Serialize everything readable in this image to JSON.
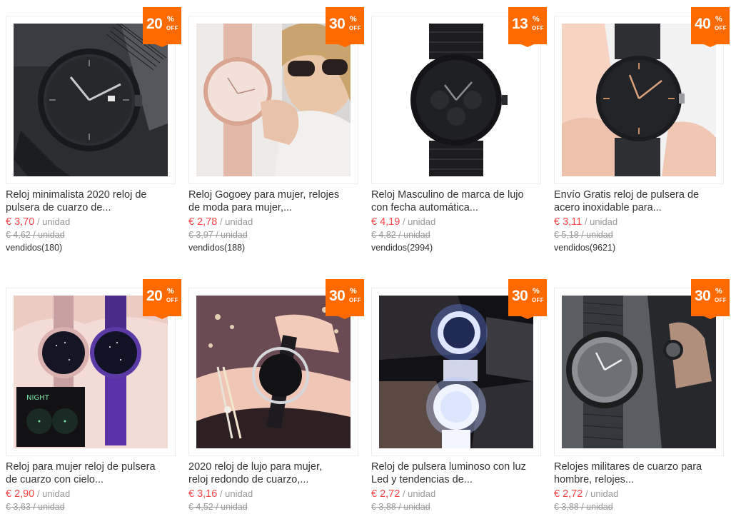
{
  "colors": {
    "accent": "#ff6a00",
    "price": "#ff4747",
    "muted": "#999999",
    "text": "#333333"
  },
  "products": [
    {
      "image": "watch-black-mesh",
      "discount": "20",
      "discount_pct": "%",
      "discount_off": "OFF",
      "title": "Reloj minimalista 2020 reloj de\npulsera de cuarzo de...",
      "price": "€ 3,70",
      "unit": " / unidad",
      "old_price": "€ 4,62 / unidad",
      "sold": "vendidos(180)"
    },
    {
      "image": "watch-pink-woman",
      "discount": "30",
      "discount_pct": "%",
      "discount_off": "OFF",
      "title": "Reloj Gogoey para mujer, relojes\nde moda para mujer,...",
      "price": "€ 2,78",
      "unit": " / unidad",
      "old_price": "€ 3,97 / unidad",
      "sold": "vendidos(188)"
    },
    {
      "image": "watch-black-steel",
      "discount": "13",
      "discount_pct": "%",
      "discount_off": "OFF",
      "title": "Reloj Masculino de marca de lujo\ncon fecha automática...",
      "price": "€ 4,19",
      "unit": " / unidad",
      "old_price": "€ 4,82 / unidad",
      "sold": "vendidos(2994)"
    },
    {
      "image": "watch-rose-gold-hands",
      "discount": "40",
      "discount_pct": "%",
      "discount_off": "OFF",
      "title": "Envío Gratis reloj de pulsera de\nacero inoxidable para...",
      "price": "€ 3,11",
      "unit": " / unidad",
      "old_price": "€ 5,18 / unidad",
      "sold": "vendidos(9621)"
    },
    {
      "image": "watch-starry-sky",
      "discount": "20",
      "discount_pct": "%",
      "discount_off": "OFF",
      "title": "Reloj para mujer reloj de pulsera\nde cuarzo con cielo...",
      "price": "€ 2,90",
      "unit": " / unidad",
      "old_price": "€ 3,63 / unidad",
      "sold": "",
      "night_label": "NIGHT"
    },
    {
      "image": "watch-hollow-bracelet",
      "discount": "30",
      "discount_pct": "%",
      "discount_off": "OFF",
      "title": "2020 reloj de lujo para mujer,\nreloj redondo de cuarzo,...",
      "price": "€ 3,16",
      "unit": " / unidad",
      "old_price": "€ 4,52 / unidad",
      "sold": ""
    },
    {
      "image": "watch-led-luminous",
      "discount": "30",
      "discount_pct": "%",
      "discount_off": "OFF",
      "title": "Reloj de pulsera luminoso con luz\nLed y tendencias de...",
      "price": "€ 2,72",
      "unit": " / unidad",
      "old_price": "€ 3,88 / unidad",
      "sold": ""
    },
    {
      "image": "watch-military-nylon",
      "discount": "30",
      "discount_pct": "%",
      "discount_off": "OFF",
      "title": "Relojes militares de cuarzo para\nhombre, relojes...",
      "price": "€ 2,72",
      "unit": " / unidad",
      "old_price": "€ 3,88 / unidad",
      "sold": ""
    }
  ]
}
